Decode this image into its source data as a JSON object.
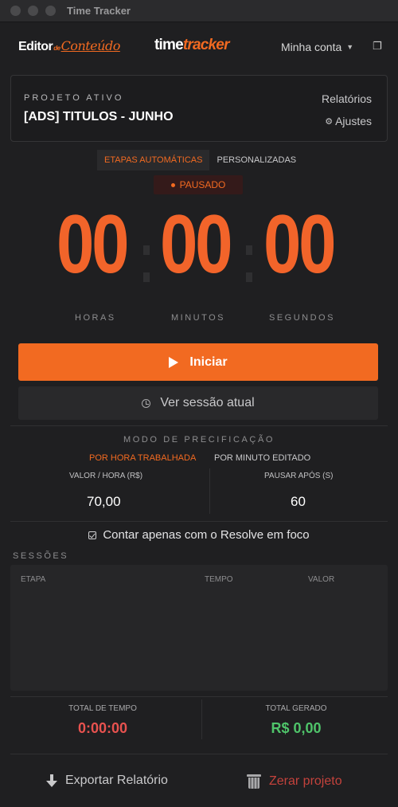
{
  "window": {
    "title": "Time Tracker"
  },
  "header": {
    "logo_editor": "Editor",
    "logo_de": "de",
    "logo_conteudo": "Conteúdo",
    "logo_time": "time",
    "logo_tracker": "tracker",
    "account_label": "Minha conta",
    "account_caret": "▼",
    "popout_icon": "❐"
  },
  "project": {
    "label": "PROJETO ATIVO",
    "name": "[ADS] TITULOS - JUNHO",
    "reports_link": "Relatórios",
    "settings_icon": "⚙",
    "settings_link": "Ajustes"
  },
  "mode_tabs": [
    {
      "label": "ETAPAS AUTOMÁTICAS",
      "active": true
    },
    {
      "label": "PERSONALIZADAS",
      "active": false
    }
  ],
  "status": {
    "label": "PAUSADO",
    "color": "#f26a21"
  },
  "timer": {
    "hours": "00",
    "minutes": "00",
    "seconds": "00",
    "hours_label": "HORAS",
    "minutes_label": "MINUTOS",
    "seconds_label": "SEGUNDOS"
  },
  "actions": {
    "start_label": "Iniciar",
    "session_label": "Ver sessão atual"
  },
  "pricing": {
    "title": "MODO DE PRECIFICAÇÃO",
    "tabs": [
      {
        "label": "POR HORA TRABALHADA",
        "active": true
      },
      {
        "label": "POR MINUTO EDITADO",
        "active": false
      }
    ],
    "rate_label": "VALOR / HORA (R$)",
    "rate_value": "70,00",
    "pause_label": "PAUSAR APÓS (S)",
    "pause_value": "60"
  },
  "focus_option": {
    "label": "Contar apenas com o Resolve em foco",
    "checked": true
  },
  "sessions": {
    "title": "SESSÕES",
    "columns": [
      "ETAPA",
      "TEMPO",
      "VALOR"
    ],
    "rows": []
  },
  "totals": {
    "time_label": "TOTAL DE TEMPO",
    "time_value": "0:00:00",
    "money_label": "TOTAL GERADO",
    "money_value": "R$ 0,00"
  },
  "footer": {
    "export_label": "Exportar Relatório",
    "reset_label": "Zerar projeto"
  },
  "colors": {
    "accent": "#f26a21",
    "danger": "#e8524f",
    "success": "#4fc46a",
    "background": "#1f1f21"
  }
}
